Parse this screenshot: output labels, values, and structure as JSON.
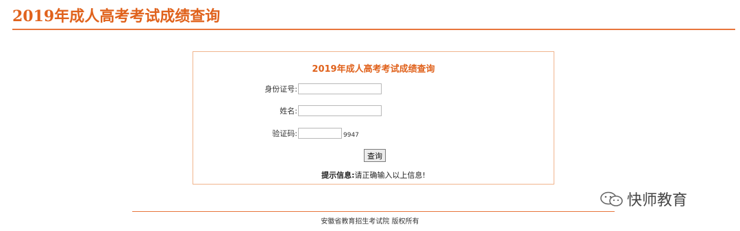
{
  "header": {
    "title": "2019年成人高考考试成绩查询"
  },
  "form": {
    "title": "2019年成人高考考试成绩查询",
    "id_label": "身份证号:",
    "id_value": "",
    "name_label": "姓名:",
    "name_value": "",
    "captcha_label": "验证码:",
    "captcha_value": "",
    "captcha_code": "9947",
    "submit_label": "查询",
    "hint_prefix": "提示信息:",
    "hint_text": "请正确输入以上信息!"
  },
  "watermark": {
    "text": "快师教育",
    "icon": "wechat-icon"
  },
  "footer": {
    "copyright": "安徽省教育招生考试院 版权所有"
  },
  "colors": {
    "accent": "#e0621c",
    "rule": "#e8743a",
    "panel_border": "#f0b48c"
  }
}
